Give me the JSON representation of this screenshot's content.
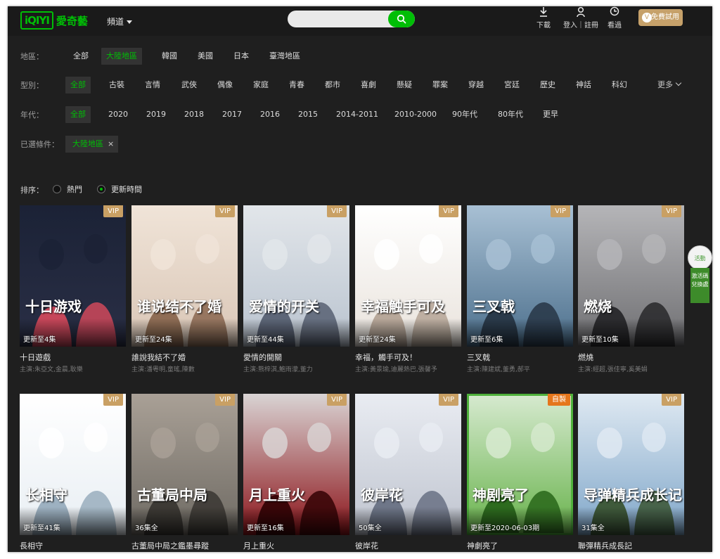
{
  "header": {
    "logo_mark": "iQIYI",
    "logo_text": "愛奇藝",
    "channel_label": "頻道",
    "search_placeholder": "",
    "download_label": "下載",
    "login_label": "登入｜註冊",
    "history_label": "看過",
    "vip_label": "免費試用",
    "vip_icon_char": "V"
  },
  "filters": {
    "region": {
      "label": "地區：",
      "options": [
        "全部",
        "大陸地區",
        "韓國",
        "美國",
        "日本",
        "臺灣地區"
      ],
      "active": "大陸地區"
    },
    "genre": {
      "label": "型別：",
      "options": [
        "全部",
        "古裝",
        "言情",
        "武俠",
        "偶像",
        "家庭",
        "青春",
        "都市",
        "喜劇",
        "懸疑",
        "罪案",
        "穿越",
        "宮廷",
        "歷史",
        "神話",
        "科幻"
      ],
      "active": "全部",
      "more_label": "更多"
    },
    "year": {
      "label": "年代：",
      "options": [
        "全部",
        "2020",
        "2019",
        "2018",
        "2017",
        "2016",
        "2015",
        "2014-2011",
        "2010-2000",
        "90年代",
        "80年代",
        "更早"
      ],
      "active": "全部"
    },
    "selected": {
      "label": "已選條件：",
      "tag": "大陸地區",
      "remove": "×"
    }
  },
  "sort": {
    "label": "排序：",
    "options": [
      "熱門",
      "更新時間"
    ],
    "active": "更新時間"
  },
  "cards": [
    {
      "title": "十日遊戲",
      "cast": "主演:朱亞文,金晨,耿樂",
      "update": "更新至4集",
      "badge": "VIP",
      "poster_text": "十日游戏"
    },
    {
      "title": "誰說我結不了婚",
      "cast": "主演:潘粵明,童瑤,陳數",
      "update": "更新至24集",
      "badge": "VIP",
      "poster_text": "谁说结不了婚"
    },
    {
      "title": "愛情的開關",
      "cast": "主演:熊梓淇,鮑雨濛,董力",
      "update": "更新至44集",
      "badge": "VIP",
      "poster_text": "爱情的开关"
    },
    {
      "title": "幸福，觸手可及！",
      "cast": "主演:黃景瑜,迪麗熱巴,張馨予",
      "update": "更新至24集",
      "badge": "VIP",
      "poster_text": "幸福触手可及"
    },
    {
      "title": "三叉戟",
      "cast": "主演:陳建斌,董勇,郝平",
      "update": "更新至6集",
      "badge": "VIP",
      "poster_text": "三叉戟"
    },
    {
      "title": "燃燒",
      "cast": "主演:經超,張佳寧,奚美娟",
      "update": "更新至10集",
      "badge": "VIP",
      "poster_text": "燃烧"
    },
    {
      "title": "長相守",
      "cast": "",
      "update": "更新至41集",
      "badge": "VIP",
      "poster_text": "长相守"
    },
    {
      "title": "古董局中局之鑑墨尋蹤",
      "cast": "",
      "update": "36集全",
      "badge": "VIP",
      "poster_text": "古董局中局"
    },
    {
      "title": "月上重火",
      "cast": "",
      "update": "更新至16集",
      "badge": "VIP",
      "poster_text": "月上重火"
    },
    {
      "title": "彼岸花",
      "cast": "",
      "update": "50集全",
      "badge": "VIP",
      "poster_text": "彼岸花"
    },
    {
      "title": "神劇亮了",
      "cast": "",
      "update": "更新至2020-06-03期",
      "badge": "自製",
      "poster_text": "神剧亮了"
    },
    {
      "title": "聯彈精兵成長記",
      "cast": "",
      "update": "31集全",
      "badge": "VIP",
      "poster_text": "导弹精兵成长记"
    }
  ],
  "side_widget": {
    "bubble_text": "活動",
    "flag_text": "激活碼兌換處"
  },
  "colors": {
    "accent": "#00be06",
    "vip": "#c9a064",
    "self": "#e5761c",
    "background": "#1f1f1f"
  }
}
